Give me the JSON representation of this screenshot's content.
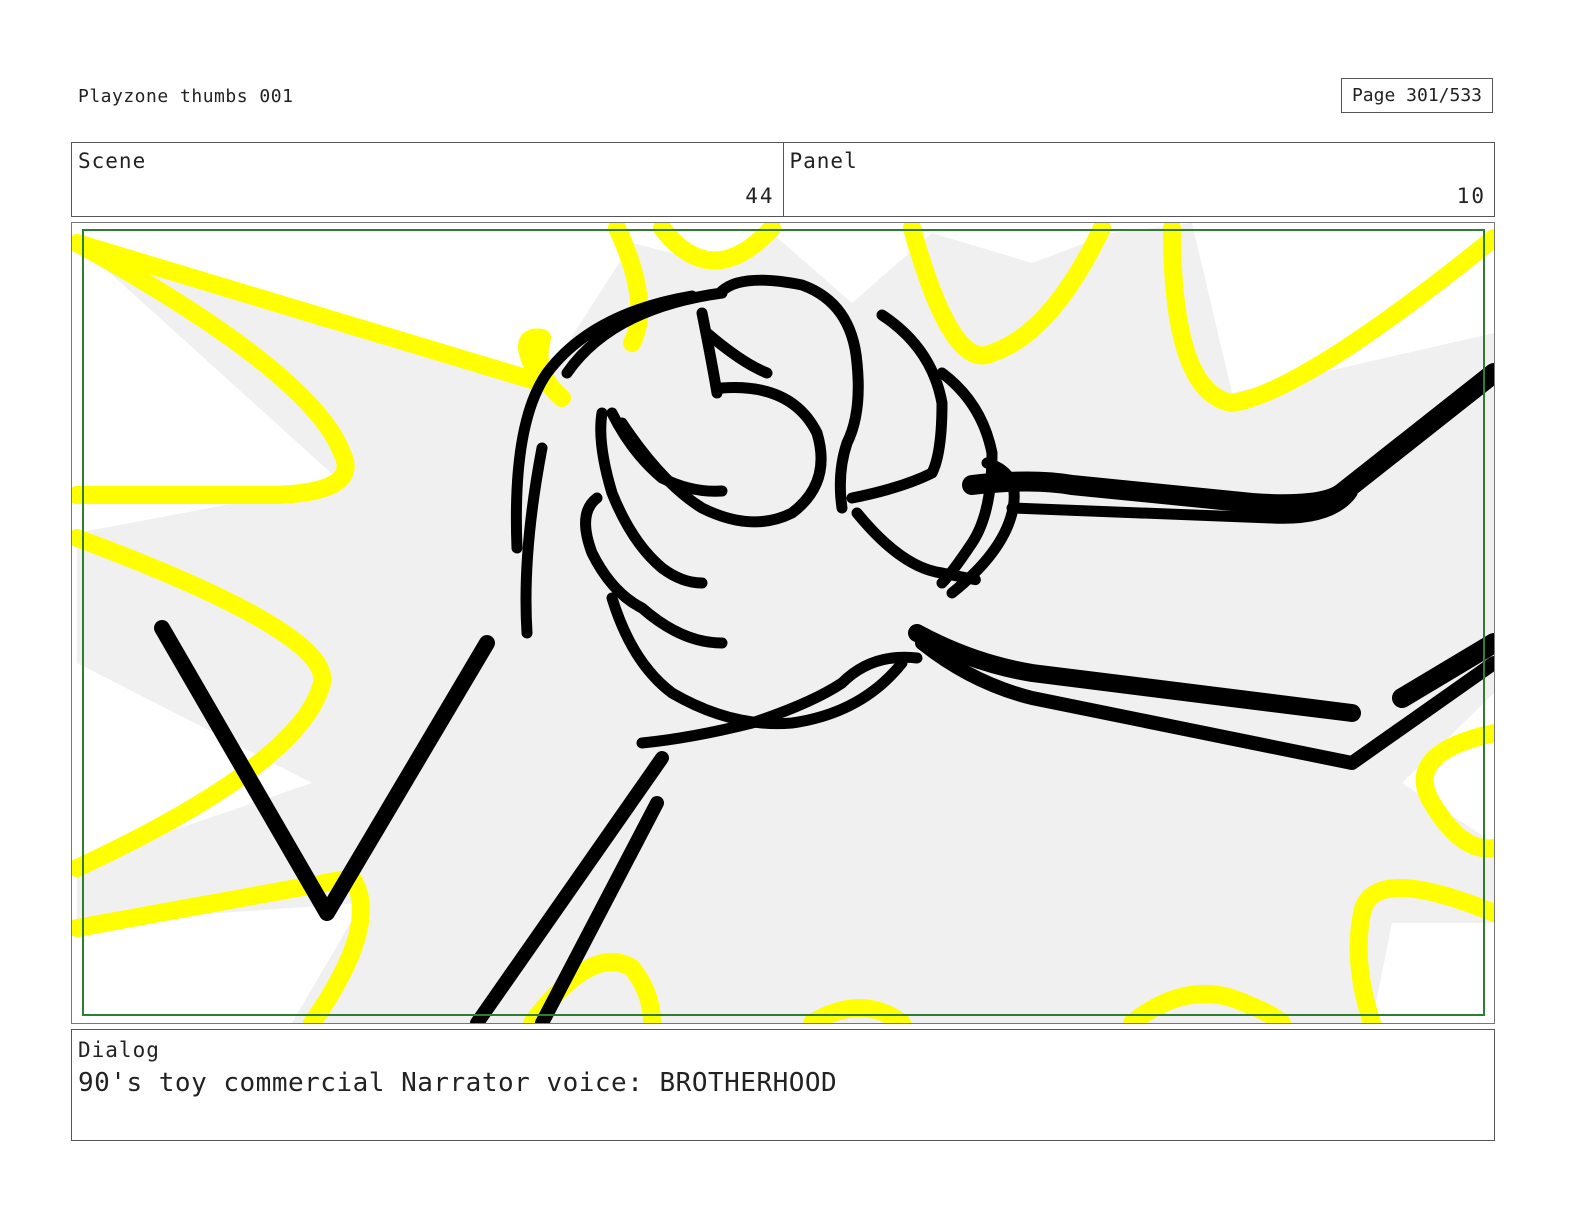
{
  "header": {
    "document_title": "Playzone thumbs 001",
    "page_label": "Page 301/533"
  },
  "info": {
    "scene_label": "Scene",
    "scene_value": "44",
    "panel_label": "Panel",
    "panel_value": "10"
  },
  "frame": {
    "description_icon": "storyboard-sketch",
    "colors": {
      "burst_fill": "#f0f0f0",
      "burst_stroke": "#ffff00",
      "ink": "#000000",
      "safe_frame": "#2e7d32"
    }
  },
  "dialog": {
    "label": "Dialog",
    "text": "90's toy commercial Narrator voice: BROTHERHOOD"
  }
}
